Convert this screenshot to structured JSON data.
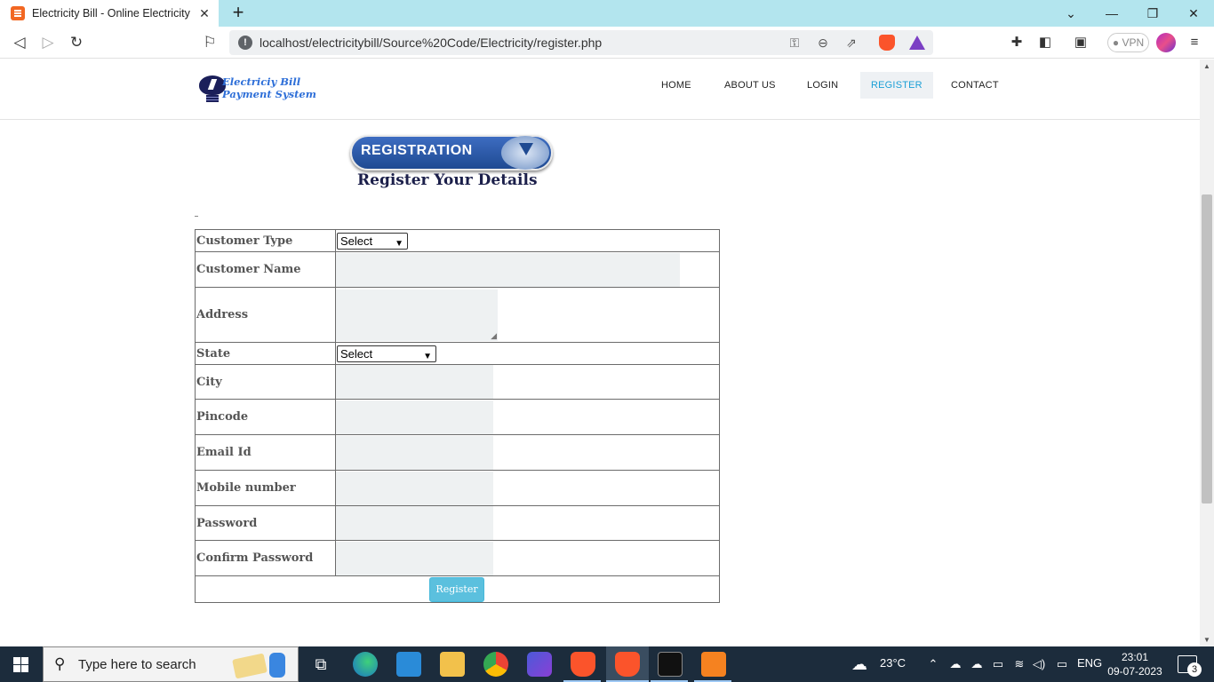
{
  "browser": {
    "tab_title": "Electricity Bill - Online Electricity B",
    "url": "localhost/electricitybill/Source%20Code/Electricity/register.php",
    "vpn_label": "VPN",
    "icons": {
      "back": "arrow-left-icon",
      "forward": "arrow-right-icon",
      "reload": "reload-icon",
      "bookmark": "bookmark-icon",
      "info": "site-info-icon",
      "key": "key-icon",
      "zoom": "zoom-icon",
      "share": "share-icon",
      "brave": "brave-shield-icon",
      "rewards": "brave-rewards-icon",
      "extensions": "puzzle-icon",
      "sidebar": "sidebar-icon",
      "wallet": "wallet-icon",
      "menu": "menu-icon"
    }
  },
  "site": {
    "logo_line1": "Electriciy Bill",
    "logo_line2": "Payment System",
    "nav": {
      "home": "HOME",
      "about": "ABOUT US",
      "login": "LOGIN",
      "register": "REGISTER",
      "contact": "CONTACT"
    },
    "accent_color": "#1a9fd6",
    "banner": {
      "title": "REGISTRATION",
      "subtitle": "Register Your Details"
    }
  },
  "form": {
    "customer_type_label": "Customer Type",
    "customer_type_value": "Select",
    "customer_name_label": "Customer Name",
    "address_label": "Address",
    "state_label": "State",
    "state_value": "Select",
    "city_label": "City",
    "pincode_label": "Pincode",
    "email_label": "Email Id",
    "mobile_label": "Mobile number",
    "password_label": "Password",
    "confirm_password_label": "Confirm Password",
    "submit_label": "Register",
    "submit_color": "#5bc0de"
  },
  "taskbar": {
    "search_placeholder": "Type here to search",
    "weather": "23°C",
    "language": "ENG",
    "time": "23:01",
    "date": "09-07-2023",
    "notification_count": "3"
  }
}
